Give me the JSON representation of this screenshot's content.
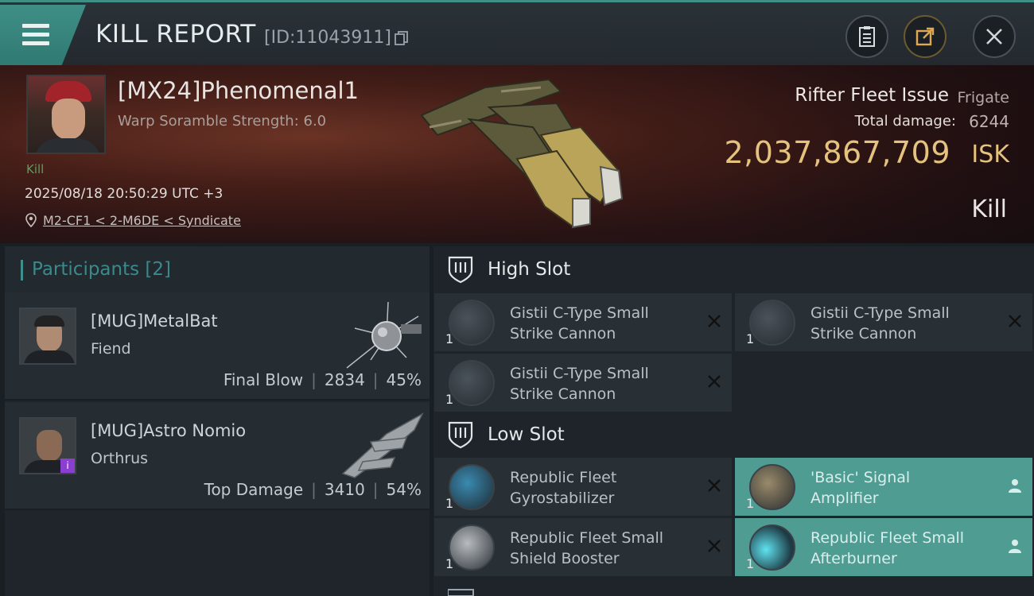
{
  "header": {
    "title": "KILL REPORT",
    "report_id": "[ID:11043911]"
  },
  "victim": {
    "name": "[MX24]Phenomenal1",
    "subtitle": "Warp Soramble Strength: 6.0",
    "badge": "Kill",
    "datetime": "2025/08/18 20:50:29 UTC +3",
    "location": "M2-CF1 < 2-M6DE < Syndicate",
    "ship_name": "Rifter Fleet Issue",
    "ship_class": "Frigate",
    "total_damage_label": "Total damage:",
    "total_damage": "6244",
    "isk_value": "2,037,867,709",
    "isk_unit": "ISK",
    "result": "Kill"
  },
  "participants": {
    "title": "Participants",
    "count": "[2]",
    "list": [
      {
        "name": "[MUG]MetalBat",
        "ship": "Fiend",
        "role": "Final Blow",
        "damage": "2834",
        "percent": "45%"
      },
      {
        "name": "[MUG]Astro Nomio",
        "ship": "Orthrus",
        "role": "Top Damage",
        "damage": "3410",
        "percent": "54%"
      }
    ]
  },
  "fitting": {
    "high_slot": {
      "title": "High Slot",
      "modules": [
        {
          "name_line1": "Gistii C-Type Small",
          "name_line2": "Strike Cannon",
          "qty": "1",
          "status": "destroyed"
        },
        {
          "name_line1": "Gistii C-Type Small",
          "name_line2": "Strike Cannon",
          "qty": "1",
          "status": "destroyed"
        },
        {
          "name_line1": "Gistii C-Type Small",
          "name_line2": "Strike Cannon",
          "qty": "1",
          "status": "destroyed"
        }
      ]
    },
    "low_slot": {
      "title": "Low Slot",
      "modules": [
        {
          "name_line1": "Republic Fleet",
          "name_line2": "Gyrostabilizer",
          "qty": "1",
          "status": "destroyed"
        },
        {
          "name_line1": "'Basic' Signal",
          "name_line2": "Amplifier",
          "qty": "1",
          "status": "dropped"
        },
        {
          "name_line1": "Republic Fleet Small",
          "name_line2": "Shield Booster",
          "qty": "1",
          "status": "destroyed"
        },
        {
          "name_line1": "Republic Fleet Small",
          "name_line2": "Afterburner",
          "qty": "1",
          "status": "dropped"
        }
      ]
    }
  },
  "colors": {
    "accent_teal": "#3f8f86",
    "isk_gold": "#e5c27d",
    "fitted_bg": "#4f9c93"
  },
  "icons": [
    "menu-icon",
    "copy-icon",
    "clipboard-icon",
    "share-icon",
    "close-icon",
    "location-pin-icon",
    "slot-shield-icon",
    "x-icon",
    "person-icon"
  ]
}
